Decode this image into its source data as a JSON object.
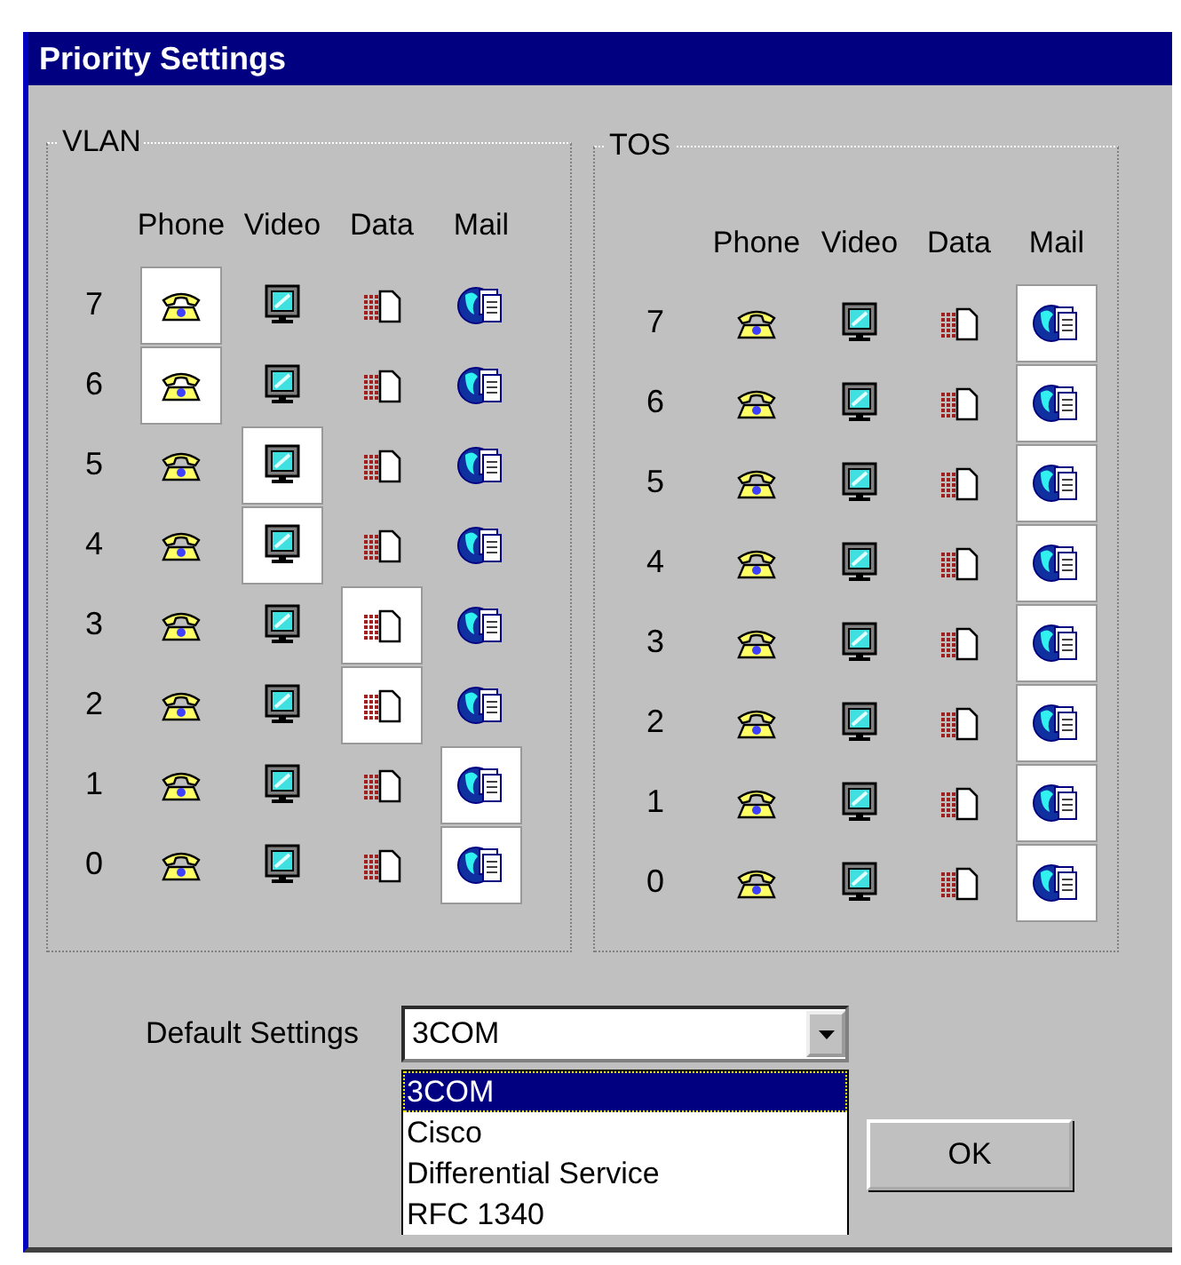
{
  "window": {
    "title": "Priority Settings"
  },
  "groups": [
    {
      "title": "VLAN",
      "columns": [
        {
          "label": "Phone",
          "kind": "phone"
        },
        {
          "label": "Video",
          "kind": "video"
        },
        {
          "label": "Data",
          "kind": "data"
        },
        {
          "label": "Mail",
          "kind": "mail"
        }
      ],
      "rows": [
        {
          "priority": "7",
          "cells": [
            {
              "selected": true
            },
            {
              "selected": false
            },
            {
              "selected": false
            },
            {
              "selected": false
            }
          ]
        },
        {
          "priority": "6",
          "cells": [
            {
              "selected": true
            },
            {
              "selected": false
            },
            {
              "selected": false
            },
            {
              "selected": false
            }
          ]
        },
        {
          "priority": "5",
          "cells": [
            {
              "selected": false
            },
            {
              "selected": true
            },
            {
              "selected": false
            },
            {
              "selected": false
            }
          ]
        },
        {
          "priority": "4",
          "cells": [
            {
              "selected": false
            },
            {
              "selected": true
            },
            {
              "selected": false
            },
            {
              "selected": false
            }
          ]
        },
        {
          "priority": "3",
          "cells": [
            {
              "selected": false
            },
            {
              "selected": false
            },
            {
              "selected": true
            },
            {
              "selected": false
            }
          ]
        },
        {
          "priority": "2",
          "cells": [
            {
              "selected": false
            },
            {
              "selected": false
            },
            {
              "selected": true
            },
            {
              "selected": false
            }
          ]
        },
        {
          "priority": "1",
          "cells": [
            {
              "selected": false
            },
            {
              "selected": false
            },
            {
              "selected": false
            },
            {
              "selected": true
            }
          ]
        },
        {
          "priority": "0",
          "cells": [
            {
              "selected": false
            },
            {
              "selected": false
            },
            {
              "selected": false
            },
            {
              "selected": true
            }
          ]
        }
      ]
    },
    {
      "title": "TOS",
      "columns": [
        {
          "label": "Phone",
          "kind": "phone"
        },
        {
          "label": "Video",
          "kind": "video"
        },
        {
          "label": "Data",
          "kind": "data"
        },
        {
          "label": "Mail",
          "kind": "mail"
        }
      ],
      "rows": [
        {
          "priority": "7",
          "cells": [
            {
              "selected": false
            },
            {
              "selected": false
            },
            {
              "selected": false
            },
            {
              "selected": true
            }
          ]
        },
        {
          "priority": "6",
          "cells": [
            {
              "selected": false
            },
            {
              "selected": false
            },
            {
              "selected": false
            },
            {
              "selected": true
            }
          ]
        },
        {
          "priority": "5",
          "cells": [
            {
              "selected": false
            },
            {
              "selected": false
            },
            {
              "selected": false
            },
            {
              "selected": true
            }
          ]
        },
        {
          "priority": "4",
          "cells": [
            {
              "selected": false
            },
            {
              "selected": false
            },
            {
              "selected": false
            },
            {
              "selected": true
            }
          ]
        },
        {
          "priority": "3",
          "cells": [
            {
              "selected": false
            },
            {
              "selected": false
            },
            {
              "selected": false
            },
            {
              "selected": true
            }
          ]
        },
        {
          "priority": "2",
          "cells": [
            {
              "selected": false
            },
            {
              "selected": false
            },
            {
              "selected": false
            },
            {
              "selected": true
            }
          ]
        },
        {
          "priority": "1",
          "cells": [
            {
              "selected": false
            },
            {
              "selected": false
            },
            {
              "selected": false
            },
            {
              "selected": true
            }
          ]
        },
        {
          "priority": "0",
          "cells": [
            {
              "selected": false
            },
            {
              "selected": false
            },
            {
              "selected": false
            },
            {
              "selected": true
            }
          ]
        }
      ]
    }
  ],
  "default_settings": {
    "label": "Default Settings",
    "value": "3COM",
    "options": [
      {
        "label": "3COM",
        "selected": true
      },
      {
        "label": "Cisco",
        "selected": false
      },
      {
        "label": "Differential Service",
        "selected": false
      },
      {
        "label": "RFC 1340",
        "selected": false
      }
    ]
  },
  "ok_button": "OK"
}
